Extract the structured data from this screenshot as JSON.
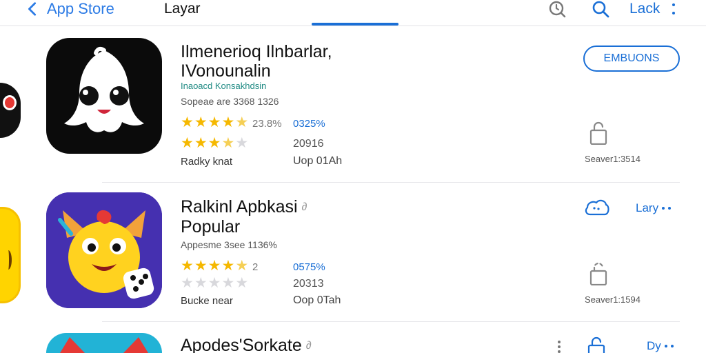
{
  "header": {
    "back_label": "App Store",
    "title": "Layar",
    "link_label": "Lack"
  },
  "apps": [
    {
      "title_line1": "Ilmenerioq Ilnbarlar,",
      "title_line2": "IVonounalin",
      "subtitle": "Inaoacd Konsakhdsin",
      "meta": "Sopeae are 3368 1326",
      "rating1": 4.5,
      "rating1_text": "23.8%",
      "percent": "0325%",
      "rating2": 3.5,
      "count": "20916",
      "tag": "Radky knat",
      "action": "Uop 01Ah",
      "button": "EMBUONS",
      "size": "Seaver1:3514",
      "icon": "ghost-icon"
    },
    {
      "title_line1": "Ralkinl Apbkasi",
      "title_line2": "Popular",
      "meta": "Appesme 3see 1136%",
      "rating1": 4.5,
      "rating1_text": "2",
      "percent": "0575%",
      "rating2": 0,
      "count": "20313",
      "tag": "Bucke near",
      "action": "Oop 0Tah",
      "link": "Lary",
      "size": "Seaver1:1594",
      "icon": "monster-icon"
    },
    {
      "title_line1": "Apodes'Sorkate",
      "link": "Dy",
      "icon": "fox-icon"
    }
  ],
  "colors": {
    "accent": "#1a6fd6",
    "star": "#f5b800",
    "teal": "#1f8a83"
  }
}
